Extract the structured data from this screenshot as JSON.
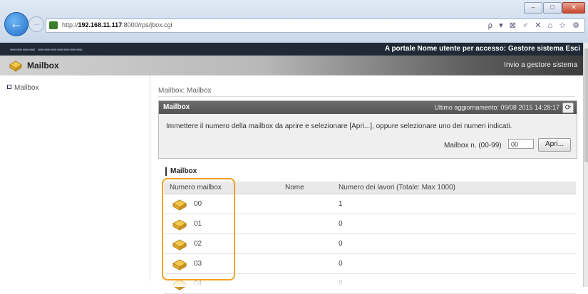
{
  "browser": {
    "url_prefix": "http://",
    "url_host": "192.168.11.117",
    "url_rest": ":8000/rps/jbox.cgi",
    "tools": "ρ ▾ ⊠ ♂ ✕   ⌂ ☆ ⚙"
  },
  "portal": {
    "links": "A portale  Nome utente per accesso: Gestore sistema Esci"
  },
  "header": {
    "title": "Mailbox",
    "goto": "Invio a gestore sistema"
  },
  "sidebar": {
    "items": [
      {
        "label": "Mailbox"
      }
    ]
  },
  "breadcrumb": "Mailbox: Mailbox",
  "panel": {
    "title": "Mailbox",
    "updated": "Ultimo aggiornamento: 09/08 2015 14:28:17",
    "instructions": "Immettere il numero della mailbox da aprire e selezionare [Apri...], oppure selezionare uno dei numeri indicati.",
    "mailbox_label": "Mailbox n. (00-99)",
    "mailbox_value": "00",
    "open_button": "Apri..."
  },
  "list": {
    "section_title": "Mailbox",
    "columns": [
      "Numero mailbox",
      "Nome",
      "Numero dei lavori (Totale: Max 1000)"
    ],
    "rows": [
      {
        "number": "00",
        "jobs": "1"
      },
      {
        "number": "01",
        "jobs": "0"
      },
      {
        "number": "02",
        "jobs": "0"
      },
      {
        "number": "03",
        "jobs": "0"
      },
      {
        "number": "04",
        "jobs": "0"
      }
    ]
  },
  "colors": {
    "highlight": "#f2a023",
    "portal_bar": "#202a36"
  }
}
